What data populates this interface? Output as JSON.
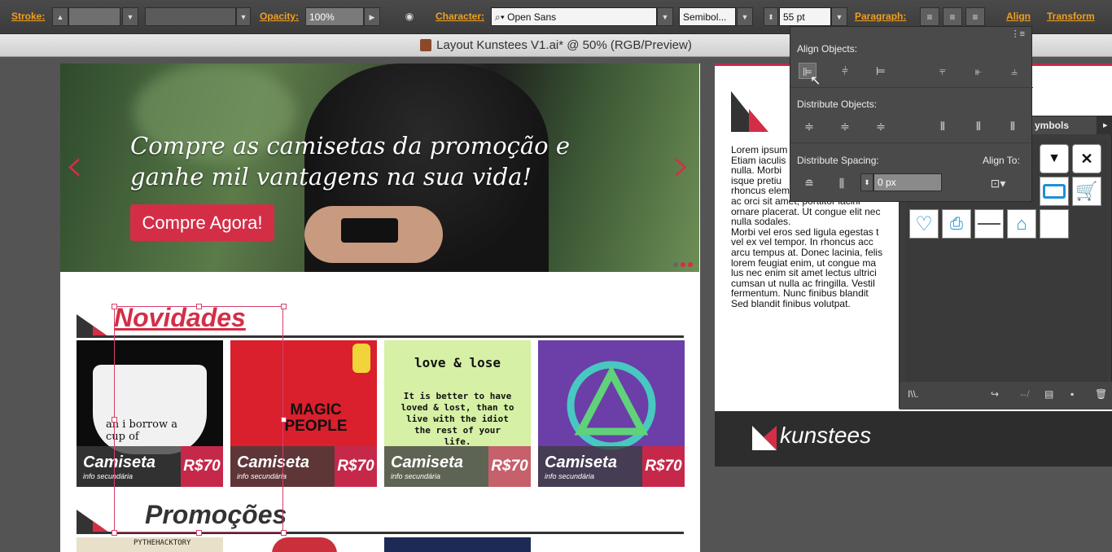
{
  "control_bar": {
    "stroke_label": "Stroke:",
    "opacity_label": "Opacity:",
    "opacity_value": "100%",
    "character_label": "Character:",
    "font_family": "Open Sans",
    "font_style": "Semibol...",
    "font_size": "55 pt",
    "paragraph_label": "Paragraph:",
    "align_label": "Align",
    "transform_label": "Transform"
  },
  "document": {
    "title": "Layout Kunstees V1.ai* @ 50% (RGB/Preview)"
  },
  "artboard_main": {
    "hero": {
      "headline_line1": "Compre as camisetas da promoção e",
      "headline_line2": "ganhe mil vantagens na sua vida!",
      "cta": "Compre Agora!",
      "prev_arrow": "‹",
      "next_arrow": "›"
    },
    "novidades_title": "Novidades",
    "promocoes_title": "Promoções",
    "products": [
      {
        "name": "Camiseta",
        "info": "info secundária",
        "price": "R$70",
        "art": "an i borrow a cup of"
      },
      {
        "name": "Camiseta",
        "info": "info secundária",
        "price": "R$70",
        "art": "MAGIC PEOPLE"
      },
      {
        "name": "Camiseta",
        "info": "info secundária",
        "price": "R$70",
        "art": "love & lose",
        "art2": "It is better to have loved & lost, than to live with the idiot the rest of your life."
      },
      {
        "name": "Camiseta",
        "info": "info secundária",
        "price": "R$70",
        "art": ""
      }
    ],
    "promo_thumb_text": "PYTHEHACKTORY"
  },
  "artboard_second": {
    "lorem": "Lorem ipsum\nEtiam iaculis\nnulla. Morbi\nisque pretiu\nrhoncus elementum ut ante.\nac orci sit amet, porttitor lacini\nornare placerat. Ut congue elit nec\nnulla sodales.\nMorbi vel eros sed ligula egestas t\nvel ex vel tempor. In rhoncus acc\narcu tempus at. Donec lacinia, felis\nlorem feugiat enim, ut congue ma\nlus nec enim sit amet lectus ultrici\ncumsan ut nulla ac fringilla. Vestil\nfermentum. Nunc finibus blandit\nSed blandit finibus volutpat.",
    "logo": "kunstees"
  },
  "align_panel": {
    "align_objects": "Align Objects:",
    "distribute_objects": "Distribute Objects:",
    "distribute_spacing": "Distribute Spacing:",
    "align_to": "Align To:",
    "spacing_value": "0 px"
  },
  "symbols_panel": {
    "tab": "ymbols",
    "library_label": "I\\\\."
  },
  "colors": {
    "accent": "#d42e47",
    "ui_orange": "#f0a020",
    "panel_bg": "#4b4b4b",
    "symbol_blue": "#1e90d8"
  }
}
